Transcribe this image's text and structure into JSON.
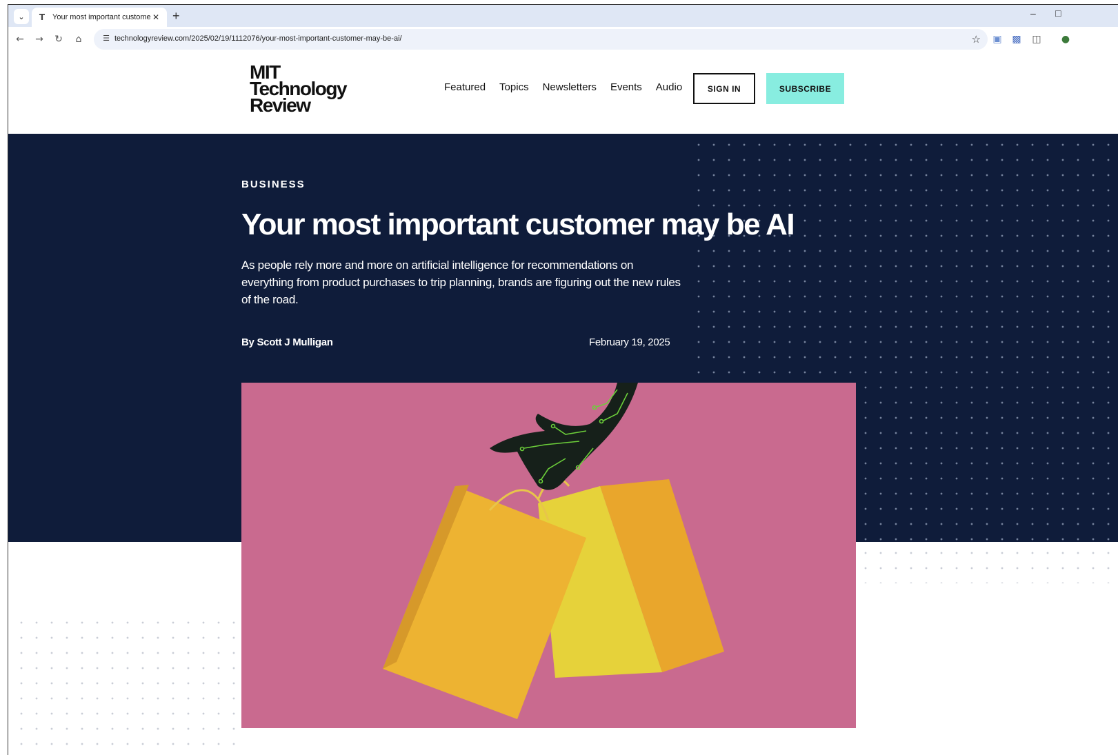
{
  "browser": {
    "tab_title": "Your most important customer",
    "url": "technologyreview.com/2025/02/19/1112076/your-most-important-customer-may-be-ai/",
    "icons": [
      "tab-list-icon",
      "favicon-icon",
      "close-icon",
      "new-tab-icon",
      "minimize-icon",
      "maximize-icon",
      "back-icon",
      "forward-icon",
      "reload-icon",
      "home-icon",
      "site-info-icon",
      "bookmark-star-icon",
      "extension-icon",
      "translate-icon",
      "puzzle-icon",
      "profile-icon"
    ]
  },
  "site": {
    "logo_line1": "MIT",
    "logo_line2": "Technology",
    "logo_line3": "Review",
    "nav": [
      "Featured",
      "Topics",
      "Newsletters",
      "Events",
      "Audio"
    ],
    "signin_label": "SIGN IN",
    "subscribe_label": "SUBSCRIBE",
    "accent_color": "#88ede0",
    "hero_bg": "#0f1c3a"
  },
  "article": {
    "category": "BUSINESS",
    "headline": "Your most important customer may be AI",
    "dek": "As people rely more and more on artificial intelligence for recommendations on everything from product purchases to trip planning, brands are figuring out the new rules of the road.",
    "byline": "By Scott J Mulligan",
    "date": "February 19, 2025"
  }
}
